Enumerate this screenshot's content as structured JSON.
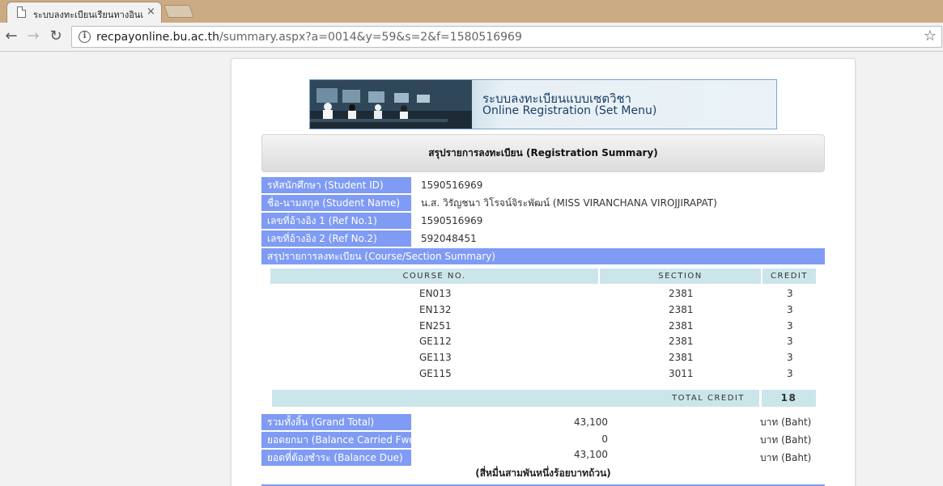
{
  "browser": {
    "tab_title": "ระบบลงทะเบียนเรียนทางอินเทอร์เน็ต",
    "tab_close": "×",
    "url_host": "recpayonline.bu.ac.th",
    "url_path": "/summary.aspx?a=0014&y=59&s=2&f=1580516969",
    "back_glyph": "←",
    "forward_glyph": "→",
    "reload_glyph": "↻",
    "info_glyph": "i",
    "star_glyph": "☆"
  },
  "banner": {
    "title_th": "ระบบลงทะเบียนแบบเซตวิชา",
    "title_en": "Online Registration (Set Menu)"
  },
  "summary": {
    "header": "สรุปรายการลงทะเบียน (Registration Summary)",
    "fields": [
      {
        "label": "รหัสนักศึกษา (Student ID)",
        "value": "1590516969"
      },
      {
        "label": "ชื่อ-นามสกุล (Student Name)",
        "value": "น.ส. วิรัญชนา วิโรจน์จิระพัฒน์ (MISS VIRANCHANA VIROJJIRAPAT)"
      },
      {
        "label": "เลขที่อ้างอิง 1 (Ref No.1)",
        "value": "1590516969"
      },
      {
        "label": "เลขที่อ้างอิง 2 (Ref No.2)",
        "value": "592048451"
      }
    ],
    "course_section_title": "สรุปรายการลงทะเบียน (Course/Section Summary)"
  },
  "courses": {
    "headers": [
      "COURSE NO.",
      "SECTION",
      "CREDIT"
    ],
    "rows": [
      {
        "course": "EN013",
        "section": "2381",
        "credit": "3"
      },
      {
        "course": "EN132",
        "section": "2381",
        "credit": "3"
      },
      {
        "course": "EN251",
        "section": "2381",
        "credit": "3"
      },
      {
        "course": "GE112",
        "section": "2381",
        "credit": "3"
      },
      {
        "course": "GE113",
        "section": "2381",
        "credit": "3"
      },
      {
        "course": "GE115",
        "section": "3011",
        "credit": "3"
      }
    ],
    "total_credit_label": "TOTAL CREDIT",
    "total_credit_value": "18"
  },
  "payment": {
    "rows": [
      {
        "label": "รวมทั้งสิ้น (Grand Total)",
        "amount": "43,100",
        "unit": "บาท (Baht)"
      },
      {
        "label": "ยอดยกมา (Balance Carried Fwd)",
        "amount": "0",
        "unit": "บาท (Baht)"
      },
      {
        "label": "ยอดที่ต้องชำระ (Balance Due)",
        "amount": "43,100",
        "unit": "บาท (Baht)"
      }
    ],
    "amount_in_words": "(สี่หมื่นสามพันหนึ่งร้อยบาทถ้วน)"
  },
  "colors": {
    "label_bg": "#7f9bf3",
    "table_head_bg": "#cbe6ea",
    "tabstrip_bg": "#cbab84"
  }
}
